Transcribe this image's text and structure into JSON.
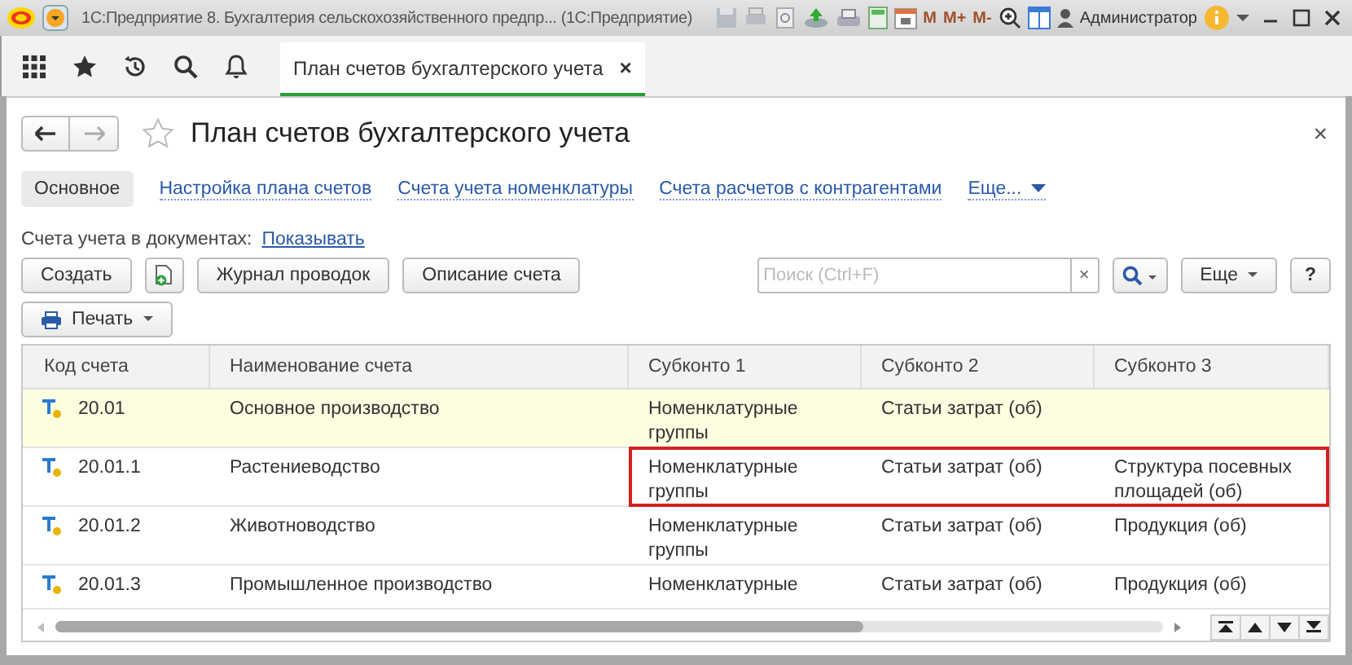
{
  "window": {
    "title": "1С:Предприятие 8. Бухгалтерия сельскохозяйственного предпр...  (1С:Предприятие)",
    "memory_buttons": [
      "M",
      "M+",
      "M-"
    ],
    "user": "Администратор"
  },
  "open_tabs": [
    {
      "label": "План счетов бухгалтерского учета",
      "selected": true,
      "close": "×"
    }
  ],
  "form": {
    "title": "План счетов бухгалтерского учета",
    "close": "×",
    "sections": [
      {
        "label": "Основное",
        "selected": true
      },
      {
        "label": "Настройка плана счетов",
        "selected": false
      },
      {
        "label": "Счета учета номенклатуры",
        "selected": false
      },
      {
        "label": "Счета расчетов с контрагентами",
        "selected": false
      }
    ],
    "more_link": "Еще...",
    "accounts_in_documents": {
      "label": "Счета учета в документах:",
      "link": "Показывать"
    },
    "buttons": [
      {
        "kind": "text",
        "label": "Создать"
      },
      {
        "kind": "icon"
      },
      {
        "kind": "text",
        "label": "Журнал проводок"
      },
      {
        "kind": "text",
        "label": "Описание счета"
      }
    ],
    "search": {
      "placeholder": "Поиск (Ctrl+F)",
      "clear": "×"
    },
    "more_button": "Еще",
    "help_button": "?",
    "print_button": "Печать"
  },
  "table": {
    "columns": [
      "Код счета",
      "Наименование счета",
      "Субконто 1",
      "Субконто 2",
      "Субконто 3"
    ],
    "rows": [
      {
        "code": "20.01",
        "name": "Основное производство",
        "subconto_1": "Номенклатурные группы",
        "subconto_2": "Статьи затрат (об)",
        "subconto_3": "",
        "selected": true,
        "outlined": false
      },
      {
        "code": "20.01.1",
        "name": "Растениеводство",
        "subconto_1": "Номенклатурные группы",
        "subconto_2": "Статьи затрат (об)",
        "subconto_3": "Структура посевных площадей (об)",
        "selected": false,
        "outlined": true
      },
      {
        "code": "20.01.2",
        "name": "Животноводство",
        "subconto_1": "Номенклатурные группы",
        "subconto_2": "Статьи затрат (об)",
        "subconto_3": "Продукция (об)",
        "selected": false,
        "outlined": false
      },
      {
        "code": "20.01.3",
        "name": "Промышленное производство",
        "subconto_1": "Номенклатурные",
        "subconto_2": "Статьи затрат (об)",
        "subconto_3": "Продукция (об)",
        "selected": false,
        "outlined": false
      }
    ]
  }
}
